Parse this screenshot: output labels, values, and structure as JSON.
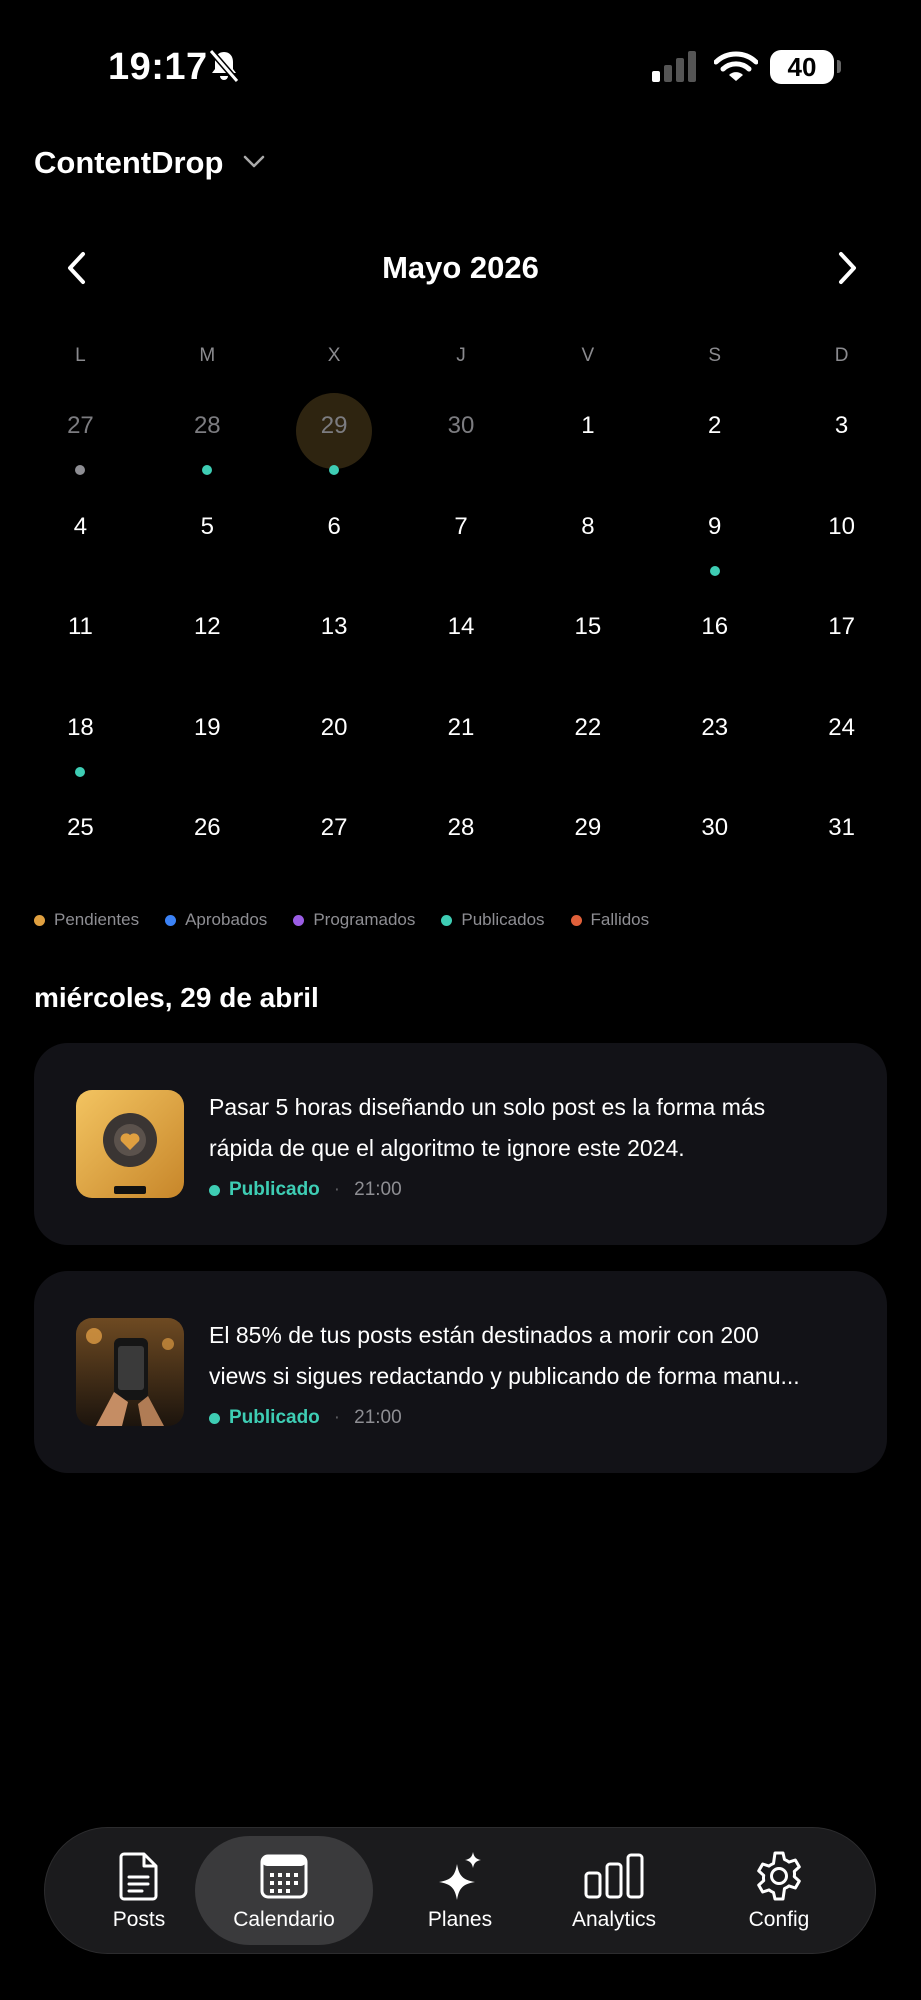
{
  "status_bar": {
    "time": "19:17",
    "battery": "40"
  },
  "header": {
    "title": "ContentDrop"
  },
  "calendar": {
    "month_title": "Mayo 2026",
    "weekdays": [
      "L",
      "M",
      "X",
      "J",
      "V",
      "S",
      "D"
    ],
    "weeks": [
      [
        {
          "day": "27",
          "other": true,
          "dot": "#8e8e93"
        },
        {
          "day": "28",
          "other": true,
          "dot": "#3ecdb4"
        },
        {
          "day": "29",
          "other": true,
          "dot": "#3ecdb4",
          "selected": true
        },
        {
          "day": "30",
          "other": true
        },
        {
          "day": "1"
        },
        {
          "day": "2"
        },
        {
          "day": "3"
        }
      ],
      [
        {
          "day": "4"
        },
        {
          "day": "5"
        },
        {
          "day": "6"
        },
        {
          "day": "7"
        },
        {
          "day": "8"
        },
        {
          "day": "9",
          "dot": "#3ecdb4"
        },
        {
          "day": "10"
        }
      ],
      [
        {
          "day": "11"
        },
        {
          "day": "12"
        },
        {
          "day": "13"
        },
        {
          "day": "14"
        },
        {
          "day": "15"
        },
        {
          "day": "16"
        },
        {
          "day": "17"
        }
      ],
      [
        {
          "day": "18",
          "dot": "#3ecdb4"
        },
        {
          "day": "19"
        },
        {
          "day": "20"
        },
        {
          "day": "21"
        },
        {
          "day": "22"
        },
        {
          "day": "23"
        },
        {
          "day": "24"
        }
      ],
      [
        {
          "day": "25"
        },
        {
          "day": "26"
        },
        {
          "day": "27"
        },
        {
          "day": "28"
        },
        {
          "day": "29"
        },
        {
          "day": "30"
        },
        {
          "day": "31"
        }
      ]
    ]
  },
  "legend": [
    {
      "label": "Pendientes",
      "color": "#e0a040"
    },
    {
      "label": "Aprobados",
      "color": "#3b82f6"
    },
    {
      "label": "Programados",
      "color": "#9b5de5"
    },
    {
      "label": "Publicados",
      "color": "#3ecdb4"
    },
    {
      "label": "Fallidos",
      "color": "#e0603a"
    }
  ],
  "selected_date": "miércoles, 29 de abril",
  "posts": [
    {
      "line1": "Pasar 5 horas diseñando un solo post es la forma más",
      "line2": "rápida de que el algoritmo te ignore este 2024.",
      "status": "Publicado",
      "time": "21:00"
    },
    {
      "line1": "El 85% de tus posts están destinados a morir con 200",
      "line2": "views si sigues redactando y publicando de forma manu...",
      "status": "Publicado",
      "time": "21:00"
    }
  ],
  "tabs": [
    {
      "label": "Posts",
      "icon": "document-icon"
    },
    {
      "label": "Calendario",
      "icon": "calendar-icon",
      "active": true
    },
    {
      "label": "Planes",
      "icon": "sparkles-icon"
    },
    {
      "label": "Analytics",
      "icon": "bar-chart-icon"
    },
    {
      "label": "Config",
      "icon": "gear-icon"
    }
  ]
}
